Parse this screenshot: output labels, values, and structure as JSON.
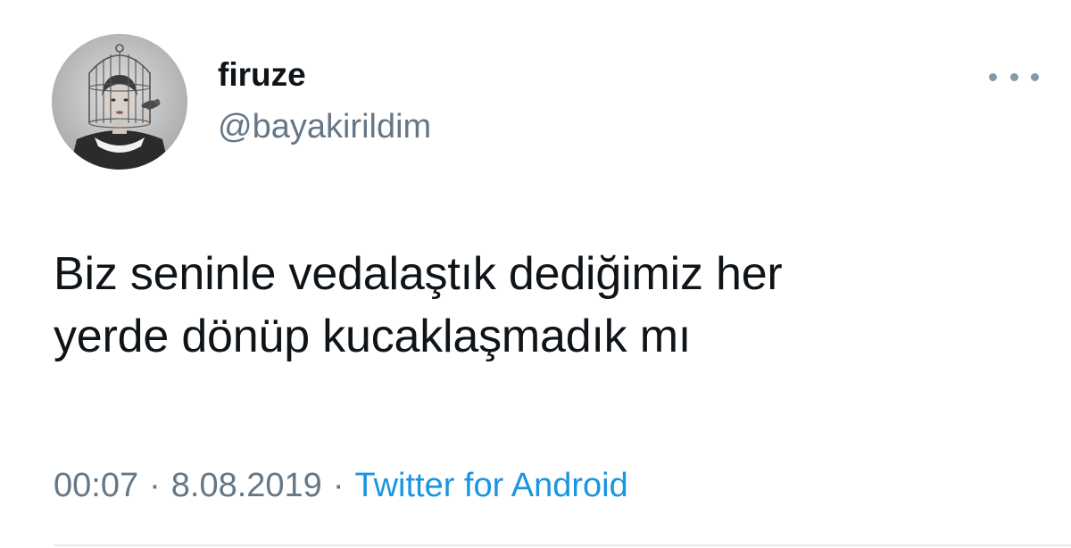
{
  "colors": {
    "text_primary": "#0f1419",
    "text_secondary": "#657786",
    "link": "#1b95e0",
    "divider": "#e6ecf0"
  },
  "user": {
    "display_name": "firuze",
    "handle": "@bayakirildim",
    "avatar_icon": "avatar-photo-woman-birdcage"
  },
  "more_menu_icon": "more-horizontal-icon",
  "tweet": {
    "text_line_1": "Biz seninle vedalaştık dediğimiz her",
    "text_line_2": "yerde dönüp kucaklaşmadık mı"
  },
  "meta": {
    "time": "00:07",
    "separator": "·",
    "date": "8.08.2019",
    "source": "Twitter for Android"
  }
}
